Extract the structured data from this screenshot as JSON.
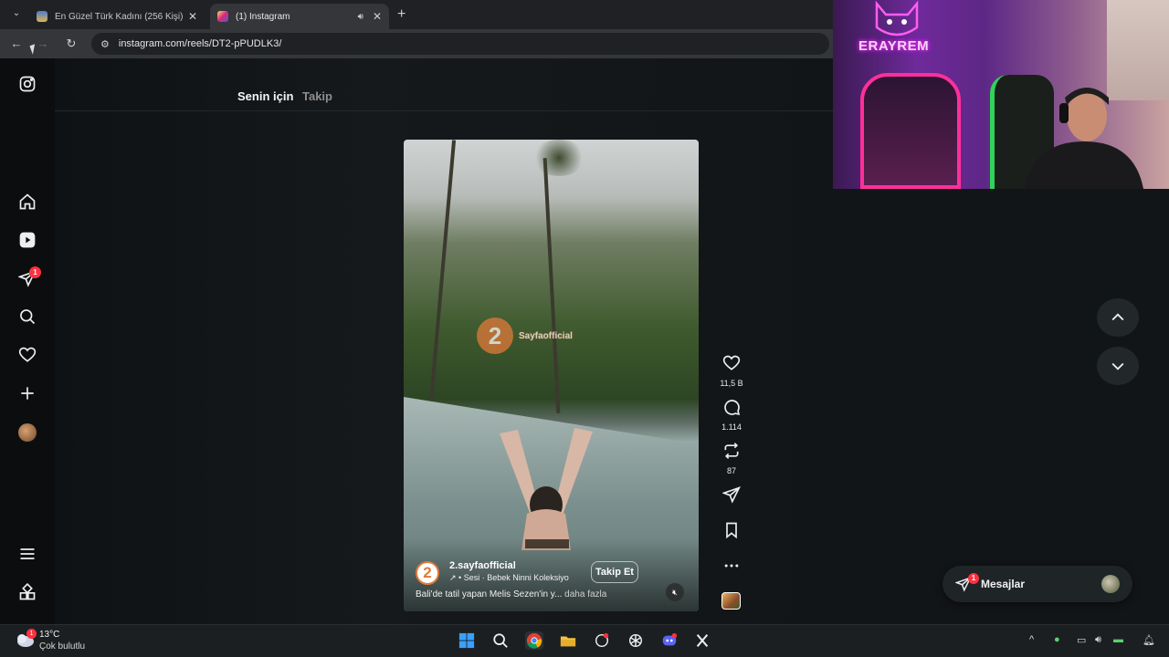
{
  "browser": {
    "tabs": [
      {
        "title": "En Güzel Türk Kadını (256 Kişi)",
        "active": false
      },
      {
        "title": "(1) Instagram",
        "active": true
      }
    ],
    "url": "instagram.com/reels/DT2-pPUDLK3/"
  },
  "sidebar": {
    "notification_count": "1"
  },
  "feed": {
    "tabs": [
      {
        "label": "Senin için",
        "active": true
      },
      {
        "label": "Takip",
        "active": false
      }
    ]
  },
  "reel": {
    "watermark": "Sayfaofficial",
    "watermark_logo": "2",
    "account_logo": "2",
    "account": "2.sayfaofficial",
    "audio": "↗ • Sesi · Bebek Ninni Koleksiyo",
    "follow_label": "Takip Et",
    "caption": "Bali'de tatil yapan Melis Sezen'in y... ",
    "caption_more": "daha fazla"
  },
  "actions": {
    "likes": "11,5 B",
    "comments": "1.114",
    "reposts": "87"
  },
  "messages": {
    "label": "Mesajlar",
    "badge": "1"
  },
  "webcam": {
    "logo_text": "ERAYREM"
  },
  "taskbar": {
    "weather_temp": "13°C",
    "weather_desc": "Çok bulutlu",
    "weather_badge": "1"
  },
  "colors": {
    "accent_red": "#ff3040",
    "bg": "#0e1113"
  }
}
